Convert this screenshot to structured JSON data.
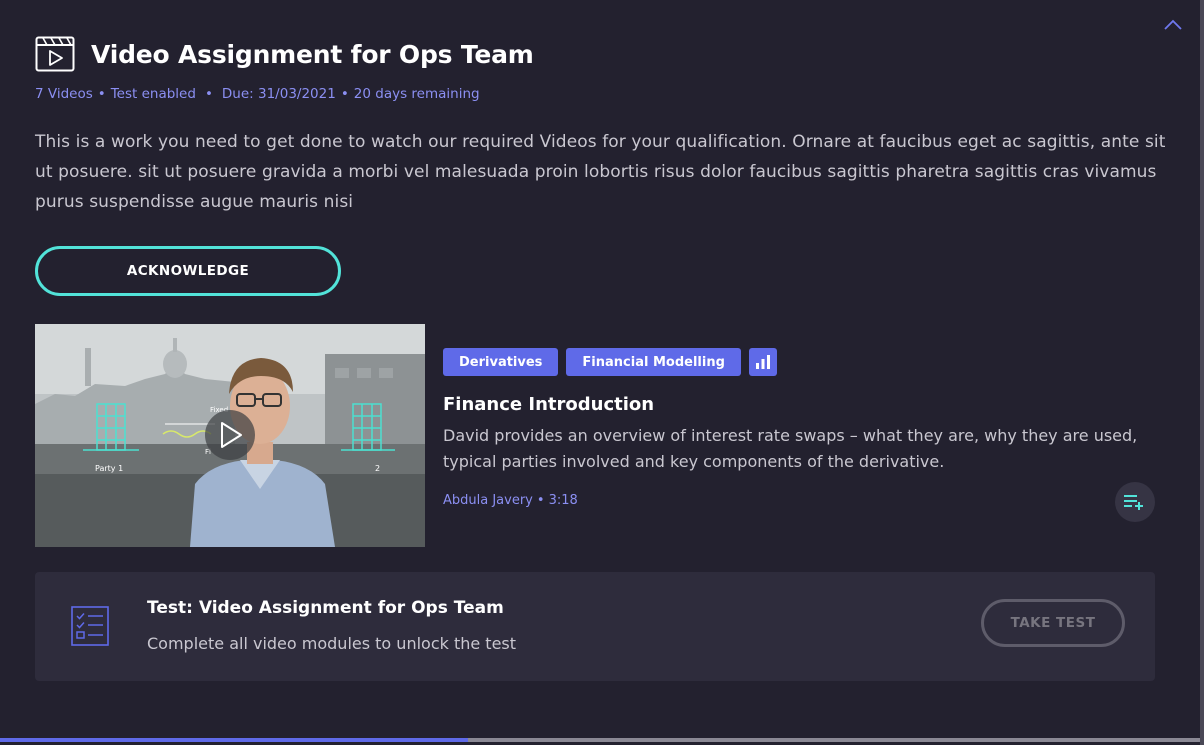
{
  "assignment": {
    "title": "Video Assignment for Ops Team",
    "meta": {
      "videos": "7 Videos",
      "test": "Test enabled",
      "due": "Due: 31/03/2021",
      "remaining": "20 days remaining"
    },
    "description": "This is a work you need to get done to watch our required Videos for your qualification. Ornare at faucibus eget ac sagittis, ante sit ut posuere. sit ut posuere gravida a morbi vel malesuada proin lobortis risus dolor faucibus sagittis pharetra sagittis cras vivamus purus suspendisse augue mauris nisi",
    "acknowledge_label": "ACKNOWLEDGE"
  },
  "video": {
    "tags": [
      "Derivatives",
      "Financial Modelling"
    ],
    "level_icon": "bar-chart-icon",
    "title": "Finance Introduction",
    "description": "David provides an overview of interest rate swaps – what they are, why they are used, typical parties involved and key components of the derivative.",
    "author": "Abdula Javery",
    "duration": "3:18",
    "thumbnail": {
      "label_left": "Party 1",
      "label_right": "2",
      "label_top": "Fixed paymen",
      "label_mid": "Fl"
    }
  },
  "test": {
    "title": "Test: Video Assignment for Ops Team",
    "subtitle": "Complete all video modules to unlock the test",
    "button_label": "TAKE TEST"
  },
  "progress": {
    "fraction": 0.39
  },
  "colors": {
    "accent": "#5f6ae8",
    "teal": "#52e3d9",
    "link": "#8b8ff2",
    "background": "#23212f"
  }
}
